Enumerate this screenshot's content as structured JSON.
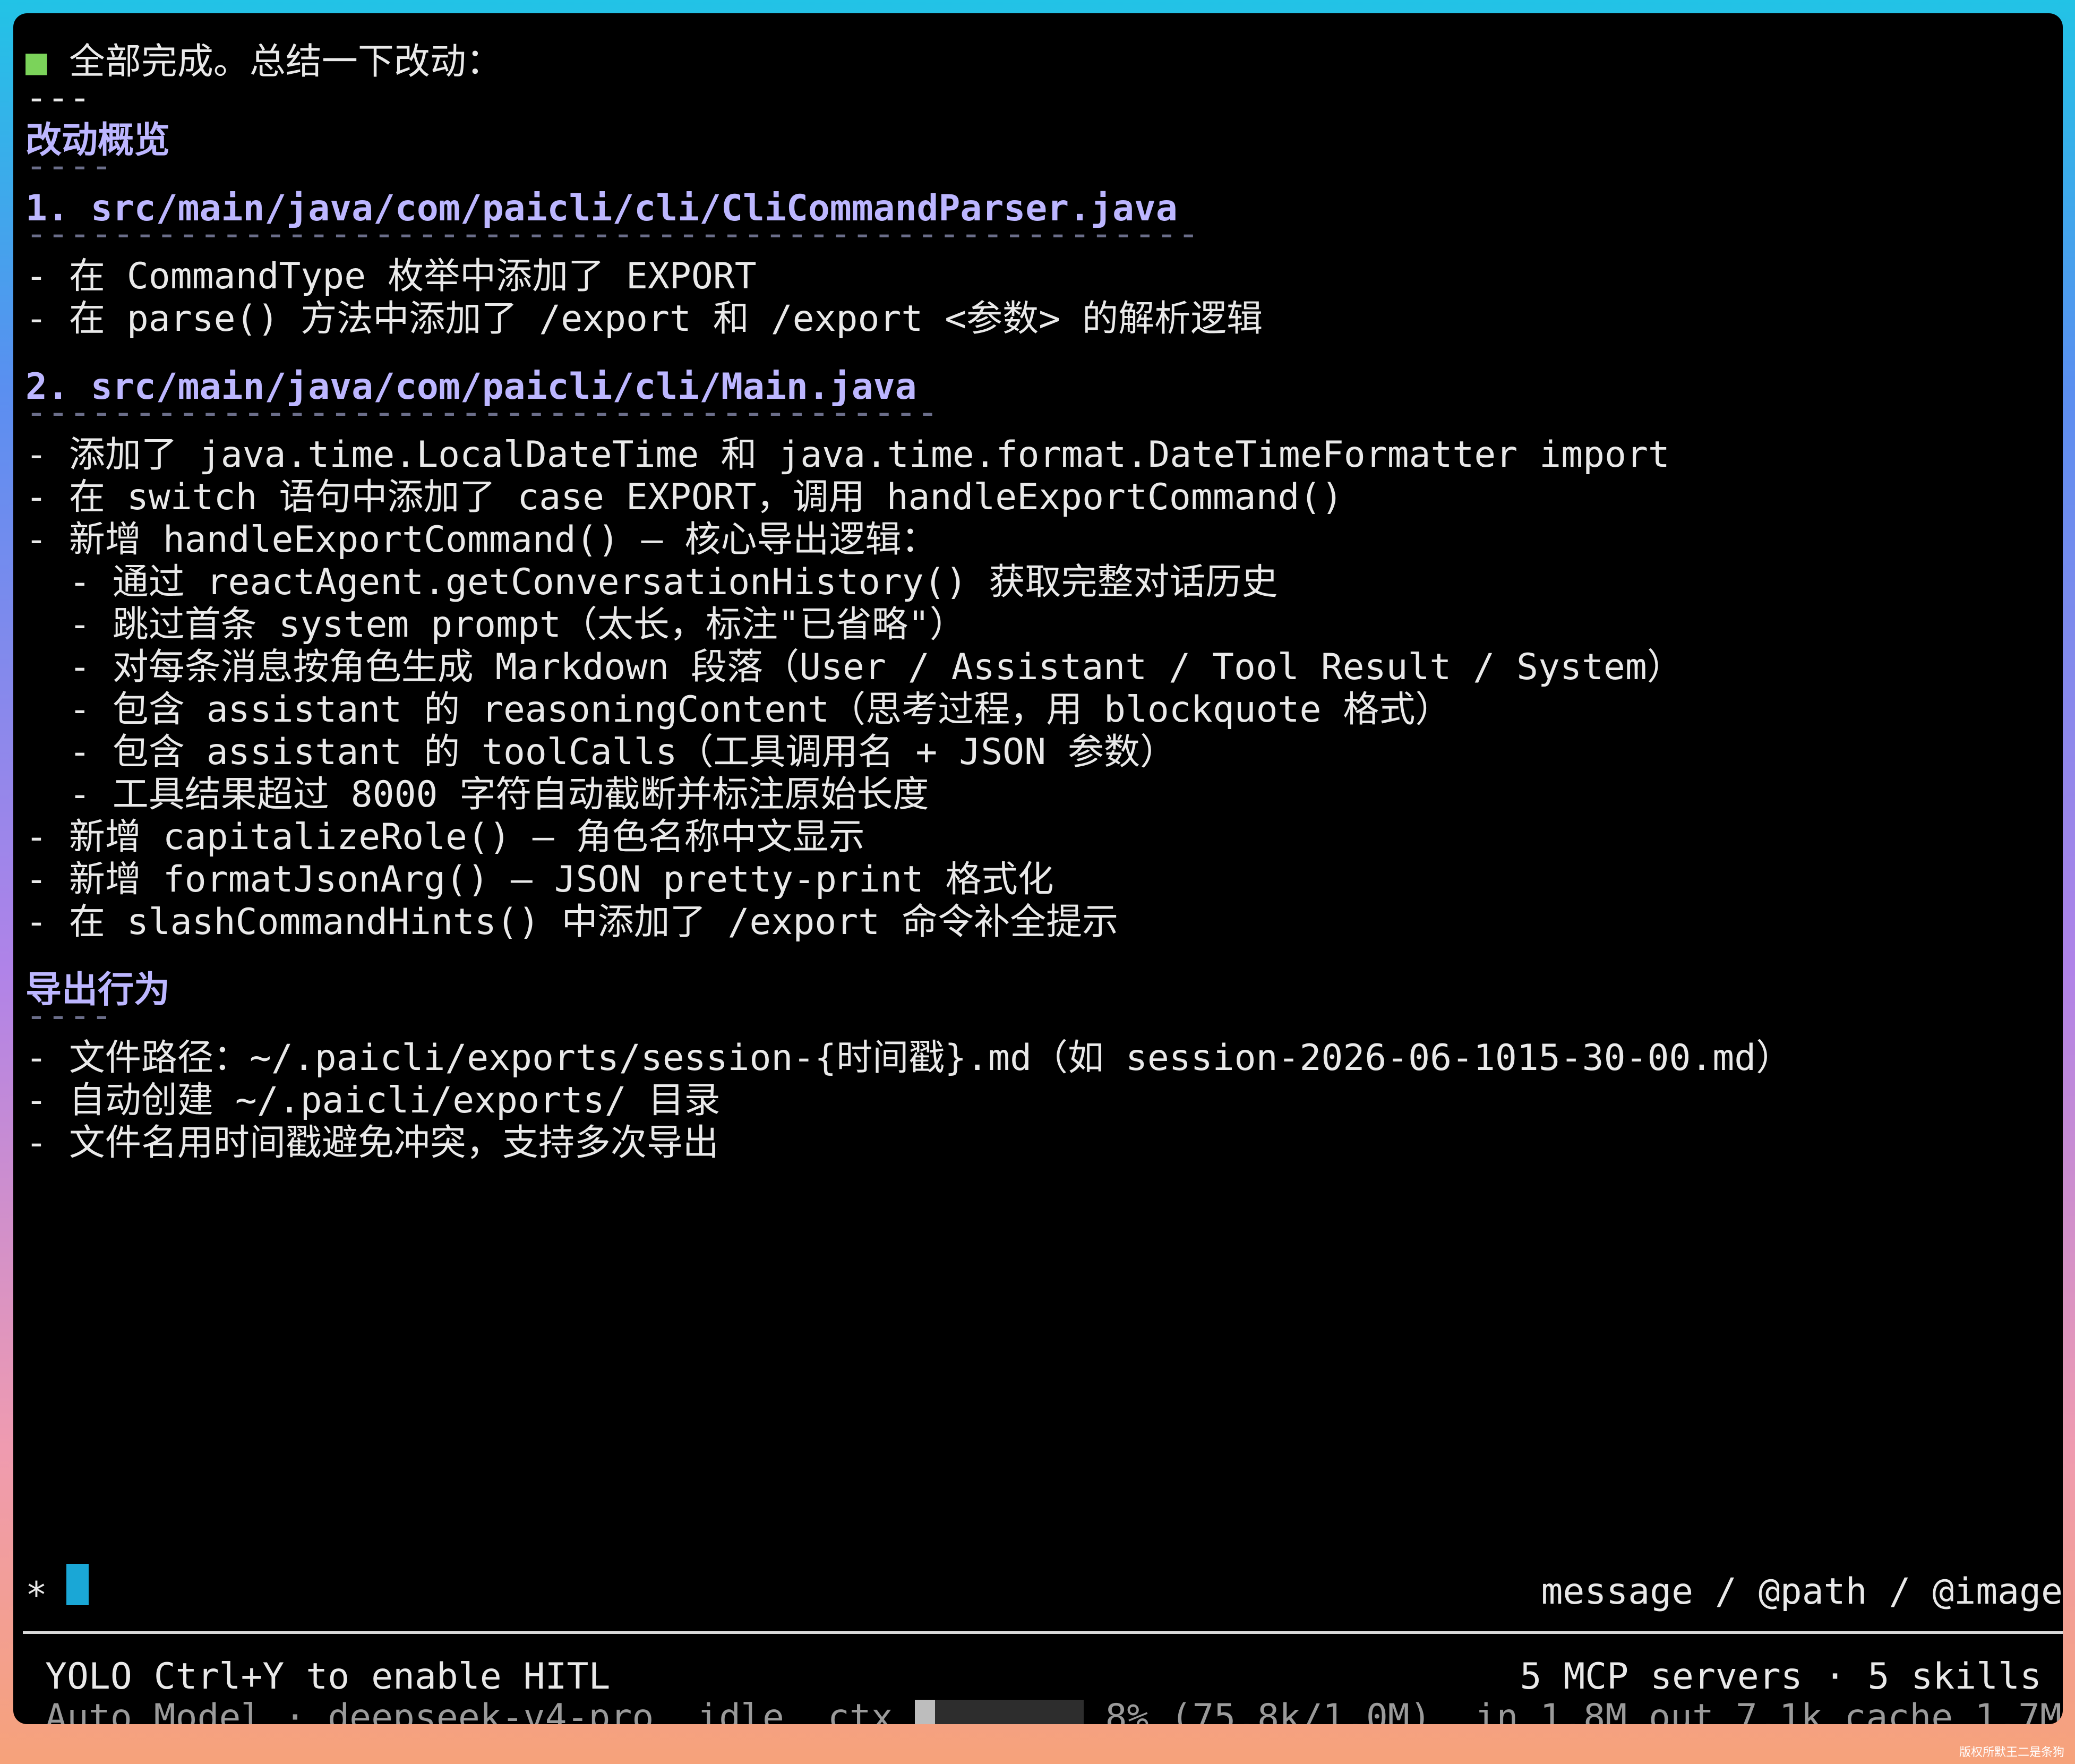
{
  "content": {
    "intro": "全部完成。总结一下改动：",
    "hr": "---",
    "section1": {
      "title": "改动概览",
      "underline": "----"
    },
    "file1": {
      "title": "1. src/main/java/com/paicli/cli/CliCommandParser.java",
      "underline": "------------------------------------------------------",
      "items": [
        "- 在 CommandType 枚举中添加了 EXPORT",
        "- 在 parse() 方法中添加了 /export 和 /export <参数> 的解析逻辑"
      ]
    },
    "file2": {
      "title": "2. src/main/java/com/paicli/cli/Main.java",
      "underline": "------------------------------------------",
      "items": [
        "- 添加了 java.time.LocalDateTime 和 java.time.format.DateTimeFormatter import",
        "- 在 switch 语句中添加了 case EXPORT，调用 handleExportCommand()",
        "- 新增 handleExportCommand() — 核心导出逻辑：",
        "  - 通过 reactAgent.getConversationHistory() 获取完整对话历史",
        "  - 跳过首条 system prompt（太长，标注\"已省略\"）",
        "  - 对每条消息按角色生成 Markdown 段落（User / Assistant / Tool Result / System）",
        "  - 包含 assistant 的 reasoningContent（思考过程，用 blockquote 格式）",
        "  - 包含 assistant 的 toolCalls（工具调用名 + JSON 参数）",
        "  - 工具结果超过 8000 字符自动截断并标注原始长度",
        "- 新增 capitalizeRole() — 角色名称中文显示",
        "- 新增 formatJsonArg() — JSON pretty-print 格式化",
        "- 在 slashCommandHints() 中添加了 /export 命令补全提示"
      ]
    },
    "section2": {
      "title": "导出行为",
      "underline": "----",
      "items": [
        "- 文件路径：~/.paicli/exports/session-{时间戳}.md（如 session-2026-06-1015-30-00.md）",
        "- 自动创建 ~/.paicli/exports/ 目录",
        "- 文件名用时间戳避免冲突，支持多次导出"
      ]
    }
  },
  "input": {
    "prompt": "*",
    "hint": "message / @path / @image"
  },
  "status": {
    "mode": "YOLO Ctrl+Y to enable HITL",
    "mcp": "5 MCP servers · 5 skills",
    "model": "Auto Model · deepseek-v4-pro",
    "state": "idle",
    "ctx_label": "ctx",
    "ctx_fraction": 0.08,
    "ctx_text": "8% (75.8k/1.0M)",
    "tokens": "in 1.8M out 7.1k cache 1.7M ·"
  },
  "watermark": "版权所默王二是条狗",
  "colors": {
    "accent": "#bcb6ff",
    "bullet": "#7bd35a",
    "cursor": "#1aa7d6"
  }
}
